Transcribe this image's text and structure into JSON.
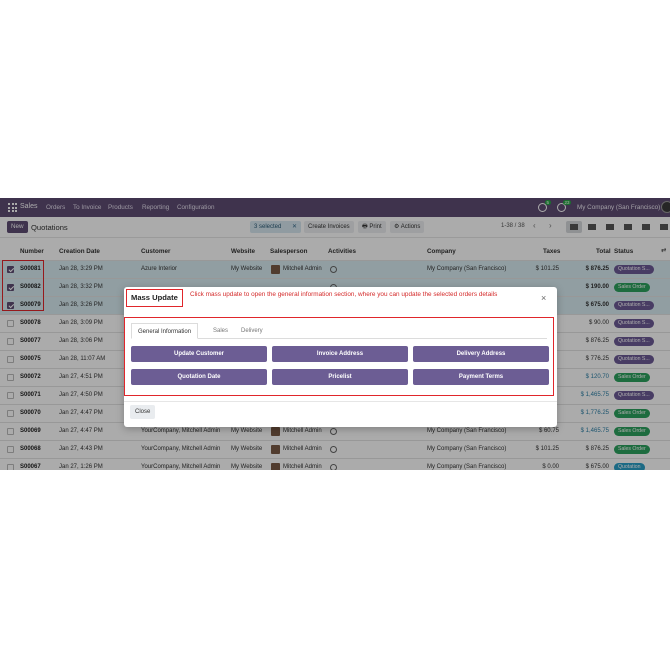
{
  "navbar": {
    "brand": "Sales",
    "menu": [
      "Orders",
      "To Invoice",
      "Products",
      "Reporting",
      "Configuration"
    ],
    "badge_messages": "5",
    "badge_activities": "23",
    "company": "My Company (San Francisco)"
  },
  "control_panel": {
    "new_label": "New",
    "title": "Quotations",
    "selected_label": "3 selected",
    "create_invoices": "Create Invoices",
    "print": "Print",
    "actions": "Actions",
    "pager": "1-38 / 38"
  },
  "table": {
    "headers": {
      "number": "Number",
      "creation_date": "Creation Date",
      "customer": "Customer",
      "website": "Website",
      "salesperson": "Salesperson",
      "activities": "Activities",
      "company": "Company",
      "taxes": "Taxes",
      "total": "Total",
      "status": "Status"
    },
    "rows": [
      {
        "number": "S00081",
        "date": "Jan 28, 3:29 PM",
        "customer": "Azure Interior",
        "website": "My Website",
        "salesperson": "Mitchell Admin",
        "company": "My Company (San Francisco)",
        "taxes": "$ 101.25",
        "total": "$ 876.25",
        "status": "Quotation S..."
      },
      {
        "number": "S00082",
        "date": "Jan 28, 3:32 PM",
        "customer": "",
        "website": "",
        "salesperson": "",
        "company": "",
        "taxes": "",
        "total": "$ 190.00",
        "status": "Sales Order"
      },
      {
        "number": "S00079",
        "date": "Jan 28, 3:26 PM",
        "customer": "",
        "website": "",
        "salesperson": "",
        "company": "",
        "taxes": "",
        "total": "$ 675.00",
        "status": "Quotation S..."
      },
      {
        "number": "S00078",
        "date": "Jan 28, 3:09 PM",
        "customer": "",
        "website": "",
        "salesperson": "",
        "company": "",
        "taxes": "",
        "total": "$ 90.00",
        "status": "Quotation S..."
      },
      {
        "number": "S00077",
        "date": "Jan 28, 3:06 PM",
        "customer": "",
        "website": "",
        "salesperson": "",
        "company": "",
        "taxes": "",
        "total": "$ 876.25",
        "status": "Quotation S..."
      },
      {
        "number": "S00075",
        "date": "Jan 28, 11:07 AM",
        "customer": "",
        "website": "",
        "salesperson": "",
        "company": "",
        "taxes": "",
        "total": "$ 776.25",
        "status": "Quotation S..."
      },
      {
        "number": "S00072",
        "date": "Jan 27, 4:51 PM",
        "customer": "",
        "website": "",
        "salesperson": "",
        "company": "",
        "taxes": "",
        "total": "$ 120.70",
        "status": "Sales Order"
      },
      {
        "number": "S00071",
        "date": "Jan 27, 4:50 PM",
        "customer": "",
        "website": "",
        "salesperson": "",
        "company": "",
        "taxes": "",
        "total": "$ 1,465.75",
        "status": "Quotation S..."
      },
      {
        "number": "S00070",
        "date": "Jan 27, 4:47 PM",
        "customer": "",
        "website": "",
        "salesperson": "",
        "company": "",
        "taxes": "",
        "total": "$ 1,776.25",
        "status": "Sales Order"
      },
      {
        "number": "S00069",
        "date": "Jan 27, 4:47 PM",
        "customer": "YourCompany, Mitchell Admin",
        "website": "My Website",
        "salesperson": "Mitchell Admin",
        "company": "My Company (San Francisco)",
        "taxes": "$ 60.75",
        "total": "$ 1,465.75",
        "status": "Sales Order"
      },
      {
        "number": "S00068",
        "date": "Jan 27, 4:43 PM",
        "customer": "YourCompany, Mitchell Admin",
        "website": "My Website",
        "salesperson": "Mitchell Admin",
        "company": "My Company (San Francisco)",
        "taxes": "$ 101.25",
        "total": "$ 876.25",
        "status": "Sales Order"
      },
      {
        "number": "S00067",
        "date": "Jan 27, 1:26 PM",
        "customer": "YourCompany, Mitchell Admin",
        "website": "My Website",
        "salesperson": "Mitchell Admin",
        "company": "My Company (San Francisco)",
        "taxes": "$ 0.00",
        "total": "$ 675.00",
        "status": "Quotation"
      }
    ]
  },
  "dialog": {
    "title": "Mass Update",
    "note": "Click mass update to open the general information section, where you can update the selected orders details",
    "close_icon": "×",
    "tabs": [
      "General Information",
      "Sales",
      "Delivery"
    ],
    "buttons": [
      "Update Customer",
      "Invoice Address",
      "Delivery Address",
      "Quotation Date",
      "Pricelist",
      "Payment Terms"
    ],
    "close_label": "Close"
  }
}
